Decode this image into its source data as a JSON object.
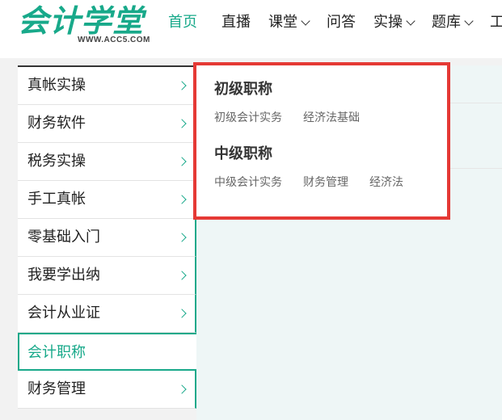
{
  "logo": {
    "text": "会计学堂",
    "url_text": "WWW.ACC5.COM",
    "color": "#18a98a"
  },
  "nav": {
    "items": [
      {
        "label": "首页",
        "active": true,
        "dropdown": false
      },
      {
        "label": "直播",
        "active": false,
        "dropdown": false
      },
      {
        "label": "课堂",
        "active": false,
        "dropdown": true
      },
      {
        "label": "问答",
        "active": false,
        "dropdown": false
      },
      {
        "label": "实操",
        "active": false,
        "dropdown": true
      },
      {
        "label": "题库",
        "active": false,
        "dropdown": true
      },
      {
        "label": "工具",
        "active": false,
        "dropdown": false
      }
    ]
  },
  "sidebar": {
    "items": [
      {
        "label": "真帐实操",
        "active": false
      },
      {
        "label": "财务软件",
        "active": false
      },
      {
        "label": "税务实操",
        "active": false
      },
      {
        "label": "手工真帐",
        "active": false
      },
      {
        "label": "零基础入门",
        "active": false
      },
      {
        "label": "我要学出纳",
        "active": false
      },
      {
        "label": "会计从业证",
        "active": false
      },
      {
        "label": "会计职称",
        "active": true
      },
      {
        "label": "财务管理",
        "active": false
      }
    ]
  },
  "popup": {
    "groups": [
      {
        "title": "初级职称",
        "links": [
          "初级会计实务",
          "经济法基础"
        ]
      },
      {
        "title": "中级职称",
        "links": [
          "中级会计实务",
          "财务管理",
          "经济法"
        ]
      }
    ]
  },
  "colors": {
    "accent": "#18a98a",
    "highlight_border": "#e53935"
  }
}
